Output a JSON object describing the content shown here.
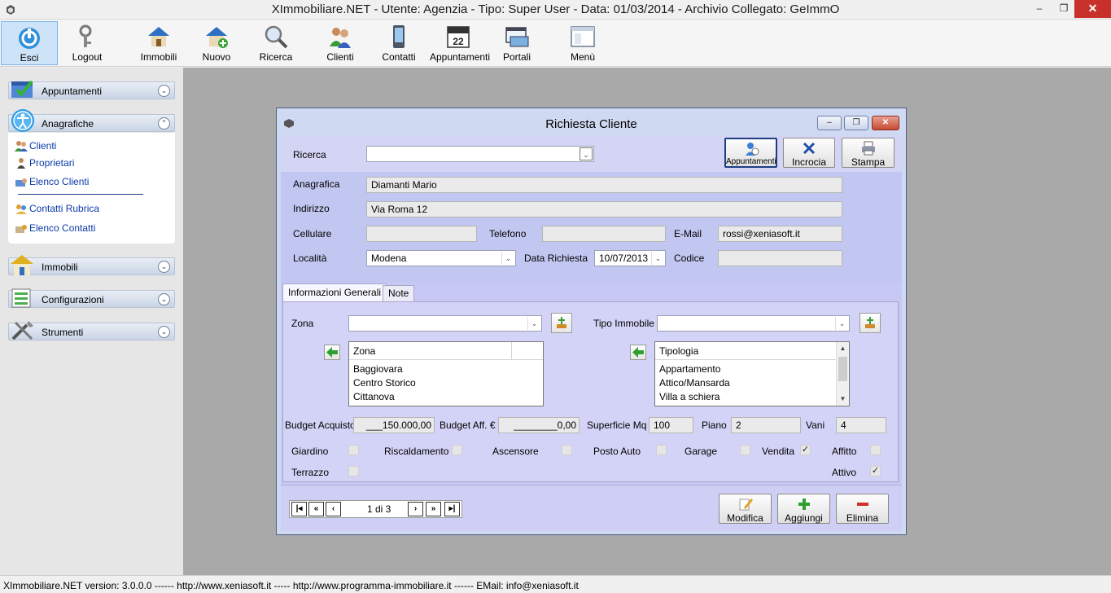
{
  "window": {
    "title": "XImmobiliare.NET - Utente: Agenzia - Tipo: Super User - Data: 01/03/2014 - Archivio Collegato: GeImmO",
    "minimize": "–",
    "restore": "❐",
    "close": "✕"
  },
  "toolbar": {
    "esci": "Esci",
    "logout": "Logout",
    "immobili": "Immobili",
    "nuovo": "Nuovo",
    "ricerca": "Ricerca",
    "clienti": "Clienti",
    "contatti": "Contatti",
    "appuntamenti": "Appuntamenti",
    "portali": "Portali",
    "menu": "Menù"
  },
  "sidebar": {
    "groups": {
      "appuntamenti": "Appuntamenti",
      "anagrafiche": "Anagrafiche",
      "immobili": "Immobili",
      "configurazioni": "Configurazioni",
      "strumenti": "Strumenti"
    },
    "items": {
      "clienti": "Clienti",
      "proprietari": "Proprietari",
      "elenco_clienti": "Elenco Clienti",
      "contatti_rubrica": "Contatti Rubrica",
      "elenco_contatti": "Elenco Contatti"
    }
  },
  "child": {
    "title": "Richiesta Cliente",
    "ricerca_label": "Ricerca",
    "ricerca_value": "",
    "buttons": {
      "appuntamenti": "Appuntamenti",
      "incrocia": "Incrocia",
      "stampa": "Stampa",
      "modifica": "Modifica",
      "aggiungi": "Aggiungi",
      "elimina": "Elimina"
    },
    "fields": {
      "anagrafica_label": "Anagrafica",
      "anagrafica": "Diamanti Mario",
      "indirizzo_label": "Indirizzo",
      "indirizzo": "Via Roma 12",
      "cellulare_label": "Cellulare",
      "cellulare": "",
      "telefono_label": "Telefono",
      "telefono": "",
      "email_label": "E-Mail",
      "email": "rossi@xeniasoft.it",
      "localita_label": "Località",
      "localita": "Modena",
      "data_richiesta_label": "Data Richiesta",
      "data_richiesta": "10/07/2013",
      "codice_label": "Codice",
      "codice": ""
    },
    "tabs": {
      "generali": "Informazioni Generali",
      "note": "Note"
    },
    "generali": {
      "zona_label": "Zona",
      "zona_value": "",
      "tipo_label": "Tipo Immobile",
      "tipo_value": "",
      "zona_list_header": "Zona",
      "zona_list": [
        "Baggiovara",
        "Centro Storico",
        "Cittanova"
      ],
      "tipologia_list_header": "Tipologia",
      "tipologia_list": [
        "Appartamento",
        "Attico/Mansarda",
        "Villa a schiera"
      ],
      "budget_acquisto_label": "Budget Acquisto",
      "budget_acquisto": "___150.000,00",
      "budget_aff_label": "Budget Aff. €",
      "budget_aff": "________0,00",
      "superficie_label": "Superficie Mq",
      "superficie": "100",
      "piano_label": "Piano",
      "piano": "2",
      "vani_label": "Vani",
      "vani": "4",
      "checks": {
        "giardino": "Giardino",
        "riscaldamento": "Riscaldamento",
        "ascensore": "Ascensore",
        "posto_auto": "Posto Auto",
        "garage": "Garage",
        "vendita": "Vendita",
        "affitto": "Affitto",
        "terrazzo": "Terrazzo",
        "attivo": "Attivo"
      },
      "checked_mark": "✓"
    },
    "navigator": {
      "first": "|◂",
      "prev_page": "«",
      "prev": "‹",
      "position": "1 di 3",
      "next": "›",
      "next_page": "»",
      "last": "▸|"
    }
  },
  "statusbar": {
    "text": "XImmobiliare.NET version: 3.0.0.0 ------ http://www.xeniasoft.it ----- http://www.programma-immobiliare.it ------ EMail: info@xeniasoft.it"
  }
}
